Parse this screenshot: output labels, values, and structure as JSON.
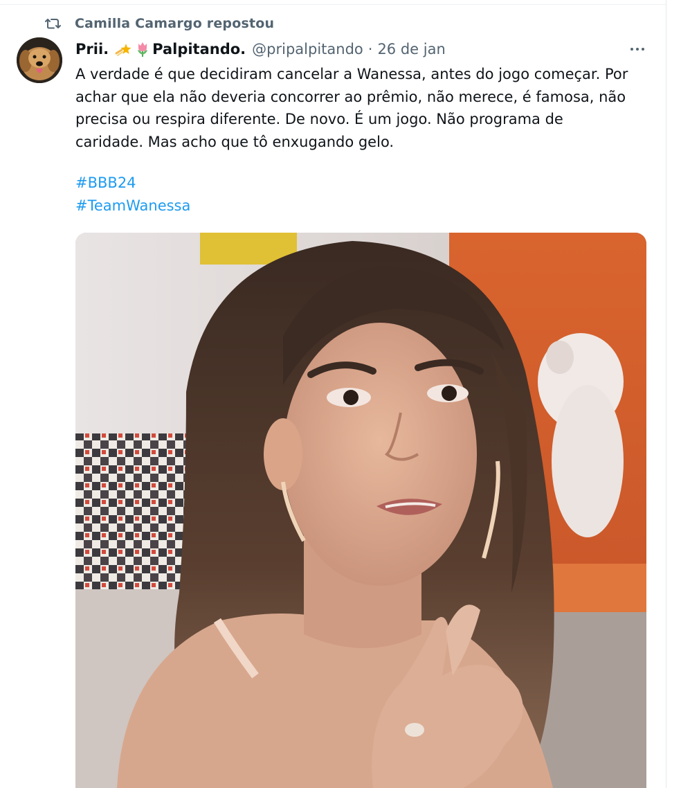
{
  "repost": {
    "icon": "repost-icon",
    "text": "Camilla Camargo repostou"
  },
  "tweet": {
    "author": {
      "avatar_icon": "dog-avatar",
      "name": "Prii.",
      "name_suffix": "Palpitando.",
      "emoji_icons": [
        "shooting-star-icon",
        "tulip-icon"
      ],
      "handle": "@pripalpitando",
      "separator": "·",
      "date": "26 de jan"
    },
    "more_icon": "more-horizontal-icon",
    "text_lines": [
      "A verdade é que decidiram cancelar a Wanessa, antes do jogo começar. Por",
      "achar que ela não deveria concorrer ao prêmio, não merece, é famosa, não",
      "precisa ou respira diferente. De novo. É um jogo. Não programa de",
      "caridade. Mas acho que tô enxugando gelo."
    ],
    "hashtags": [
      "#BBB24",
      "#TeamWanessa"
    ],
    "media": {
      "type": "photo",
      "subject": "woman with long dark hair gesturing"
    }
  },
  "colors": {
    "text_primary": "#0f1419",
    "text_secondary": "#536471",
    "link": "#1d9bf0",
    "background": "#ffffff"
  }
}
